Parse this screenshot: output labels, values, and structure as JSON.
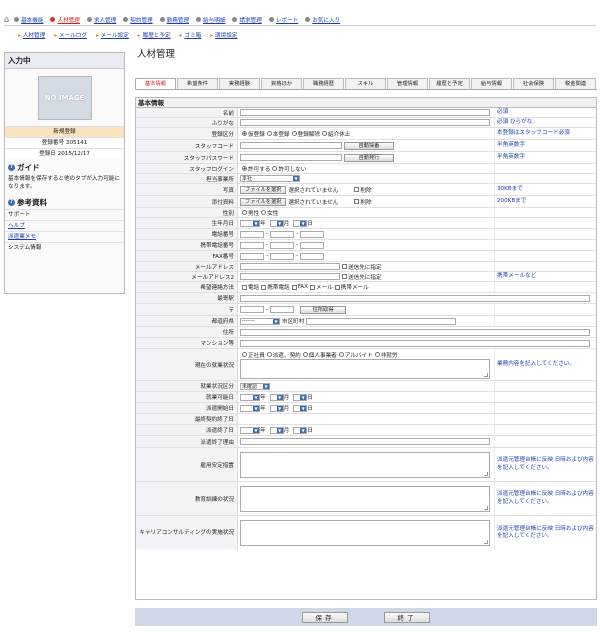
{
  "topnav": {
    "home_icon": "home-icon",
    "items": [
      "基本機能",
      "人材管理",
      "求人管理",
      "契約管理",
      "勤務管理",
      "給与明細",
      "請求管理",
      "レポート",
      "お気に入り"
    ]
  },
  "subnav": [
    "人材管理",
    "メールログ",
    "メール設定",
    "履歴と予定",
    "ゴミ箱",
    "環境設定"
  ],
  "page_title": "人材管理",
  "sidebar": {
    "header": "入力中",
    "no_image": "NO IMAGE",
    "status": "新規登録",
    "reg_no": "登録番号 305141",
    "reg_date": "登録日 2015/12/17",
    "guide_title": "ガイド",
    "guide_text": "基本情報を保存すると他のタブが入力可能になります。",
    "ref_title": "参考資料",
    "links": [
      "サポート",
      "ヘルプ",
      "派遣業メモ",
      "システム情報"
    ]
  },
  "tabs": [
    "基本情報",
    "希望条件",
    "実務経験",
    "資格ほか",
    "職務経歴",
    "スキル",
    "管理情報",
    "履歴と予定",
    "給与情報",
    "社会保険",
    "税金関連"
  ],
  "form": {
    "title": "基本情報",
    "labels": {
      "name": "名前",
      "kana": "ふりがな",
      "reg_type": "登録区分",
      "staff_code": "スタッフコード",
      "staff_pw": "スタッフパスワード",
      "staff_login": "スタッフログイン",
      "office": "担当事業所",
      "photo": "写真",
      "attach": "添付資料",
      "gender": "性別",
      "birthday": "生年月日",
      "phone": "電話番号",
      "mobile": "携帯電話番号",
      "fax": "FAX番号",
      "email": "メールアドレス",
      "email2": "メールアドレス2",
      "contact": "希望連絡方法",
      "station": "最寄駅",
      "zip": "〒",
      "pref": "都道府県",
      "address": "住所",
      "mansion": "マンション等",
      "employment": "現在の就業状況",
      "emp_type": "就業状況区分",
      "avail_date": "就業可能日",
      "dispatch_start": "派遣開始日",
      "last_contract": "最終契約終了日",
      "dispatch_end": "派遣終了日",
      "end_reason": "派遣終了理由",
      "employment_measures": "雇用安定措置",
      "education": "教育訓練の状況",
      "career": "キャリアコンサルティングの実施状況"
    },
    "notes": {
      "name": "必須",
      "kana": "必須 ひらがな",
      "reg_type": "本登録はスタッフコード必須",
      "staff_code": "半角英数字",
      "staff_pw": "半角英数字",
      "photo": "30KBまで",
      "attach": "200KBまで",
      "email2": "携帯メールなど",
      "employment": "業務内容を記入してください。",
      "employment_measures": "派遣元管理台帳に反映 日時および内容を記入してください。",
      "education": "派遣元管理台帳に反映 日時および内容を記入してください。",
      "career": "派遣元管理台帳に反映 日時および内容を記入してください。"
    },
    "reg_options": [
      "仮登録",
      "本登録",
      "登録解除",
      "紹介休止"
    ],
    "auto_assign": "自動採番",
    "auto_issue": "自動発行",
    "login_options": [
      "許可する",
      "許可しない"
    ],
    "office_value": "本社",
    "file_btn": "ファイルを選択",
    "no_file": "選択されていません",
    "delete": "削除",
    "gender_options": [
      "男性",
      "女性"
    ],
    "date_units": {
      "year": "年",
      "month": "月",
      "day": "日"
    },
    "send_to": "送信先に指定",
    "contact_options": [
      "電話",
      "携帯電話",
      "FAX",
      "メール",
      "携帯メール"
    ],
    "address_lookup": "住所取得",
    "pref_value": "-------",
    "city_label": "市区町村",
    "emp_options": [
      "正社員",
      "派遣、契約",
      "個人事業者",
      "アルバイト",
      "非就労"
    ],
    "emp_type_value": "未確認"
  },
  "footer": {
    "save": "保存",
    "close": "終了"
  }
}
